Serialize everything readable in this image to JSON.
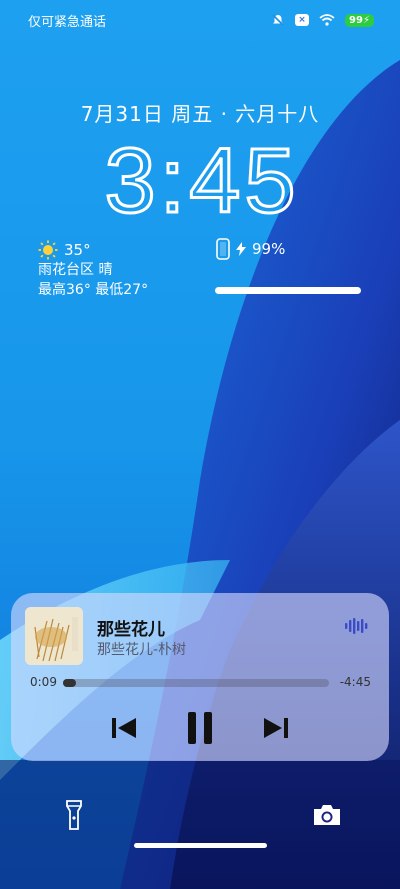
{
  "status_bar": {
    "left_text": "仅可紧急通话",
    "battery_label": "99"
  },
  "lockscreen": {
    "date": "7月31日 周五 · 六月十八",
    "time": "3:45"
  },
  "weather": {
    "icon": "sun-icon",
    "temperature": "35°",
    "location_condition": "雨花台区 晴",
    "range": "最高36° 最低27°"
  },
  "device_battery": {
    "icon": "phone-icon",
    "charging_icon": "bolt-icon",
    "percent": "99%",
    "level": 0.99
  },
  "music_player": {
    "title": "那些花儿",
    "subtitle": "那些花儿-朴树",
    "elapsed": "0:09",
    "remaining": "-4:45",
    "progress": 0.03,
    "controls": [
      "previous-icon",
      "pause-icon",
      "next-icon"
    ],
    "audio_output_icon": "waveform-icon"
  },
  "shortcuts": {
    "left": "flashlight-icon",
    "right": "camera-icon"
  },
  "colors": {
    "player_bg": "#d7daff",
    "battery_green": "#2ecc40"
  }
}
